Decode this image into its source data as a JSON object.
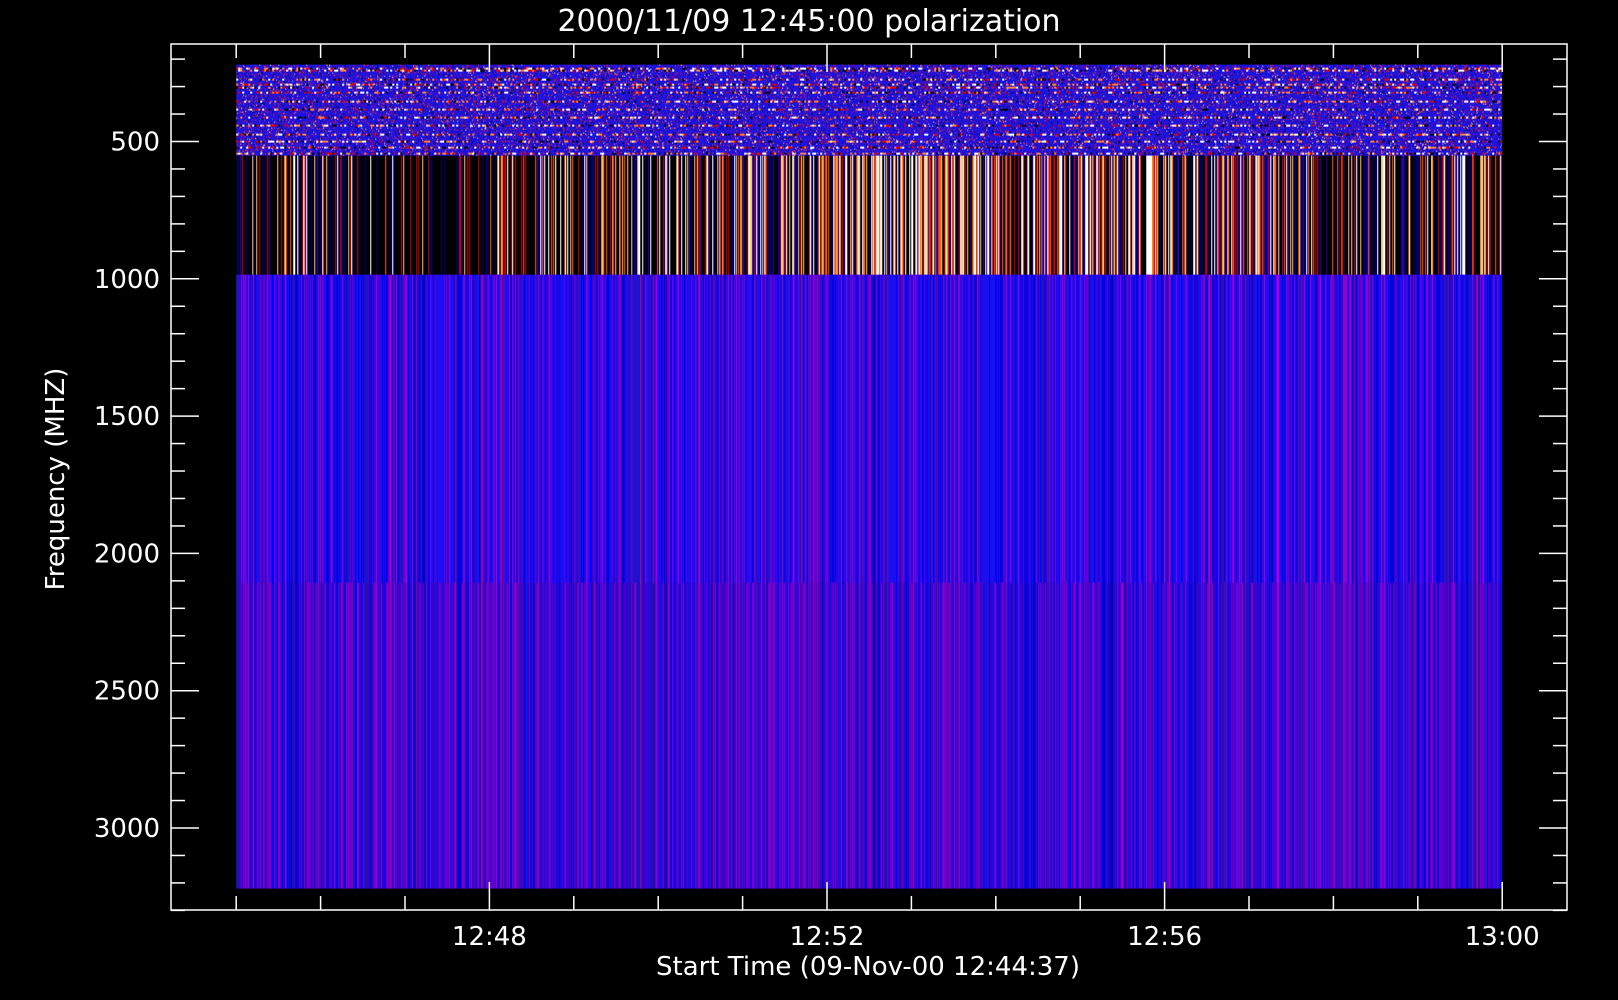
{
  "chart_data": {
    "type": "heatmap",
    "title": "2000/11/09 12:45:00 polarization",
    "xlabel": "Start Time (09-Nov-00 12:44:37)",
    "ylabel": "Frequency (MHZ)",
    "x_axis": {
      "unit": "time",
      "range": [
        "12:44:37",
        "13:00:00"
      ],
      "ticks": [
        {
          "value": "12:48",
          "minutes": 228
        },
        {
          "value": "12:52",
          "minutes": 232
        },
        {
          "value": "12:56",
          "minutes": 236
        },
        {
          "value": "13:00",
          "minutes": 240
        }
      ],
      "minor_tick_step_minutes": 1
    },
    "y_axis": {
      "unit": "MHz",
      "range": [
        200,
        3350
      ],
      "inverted": true,
      "ticks": [
        500,
        1000,
        1500,
        2000,
        2500,
        3000
      ],
      "minor_tick_step": 100
    },
    "data_extent": {
      "time_start_minutes": 225,
      "time_end_minutes": 240,
      "freq_min": 220,
      "freq_max": 3220
    },
    "bands": [
      {
        "name": "low-band",
        "freq_range": [
          220,
          550
        ],
        "pattern": "noisy speckle with horizontal streaks",
        "dominant_color": "#1414e6"
      },
      {
        "name": "mid-band",
        "freq_range": [
          550,
          985
        ],
        "pattern": "vertical stripes, intense bursts 12:51-12:58",
        "dominant_color": "#000000"
      },
      {
        "name": "high-band",
        "freq_range": [
          985,
          3220
        ],
        "pattern": "fine vertical striations",
        "dominant_color": "#1a0ff0",
        "step_at": 2105
      }
    ],
    "colormap": [
      "#000000",
      "#0000ff",
      "#ff0000",
      "#ffa500",
      "#ffffff"
    ],
    "grid": false,
    "legend": "none"
  }
}
